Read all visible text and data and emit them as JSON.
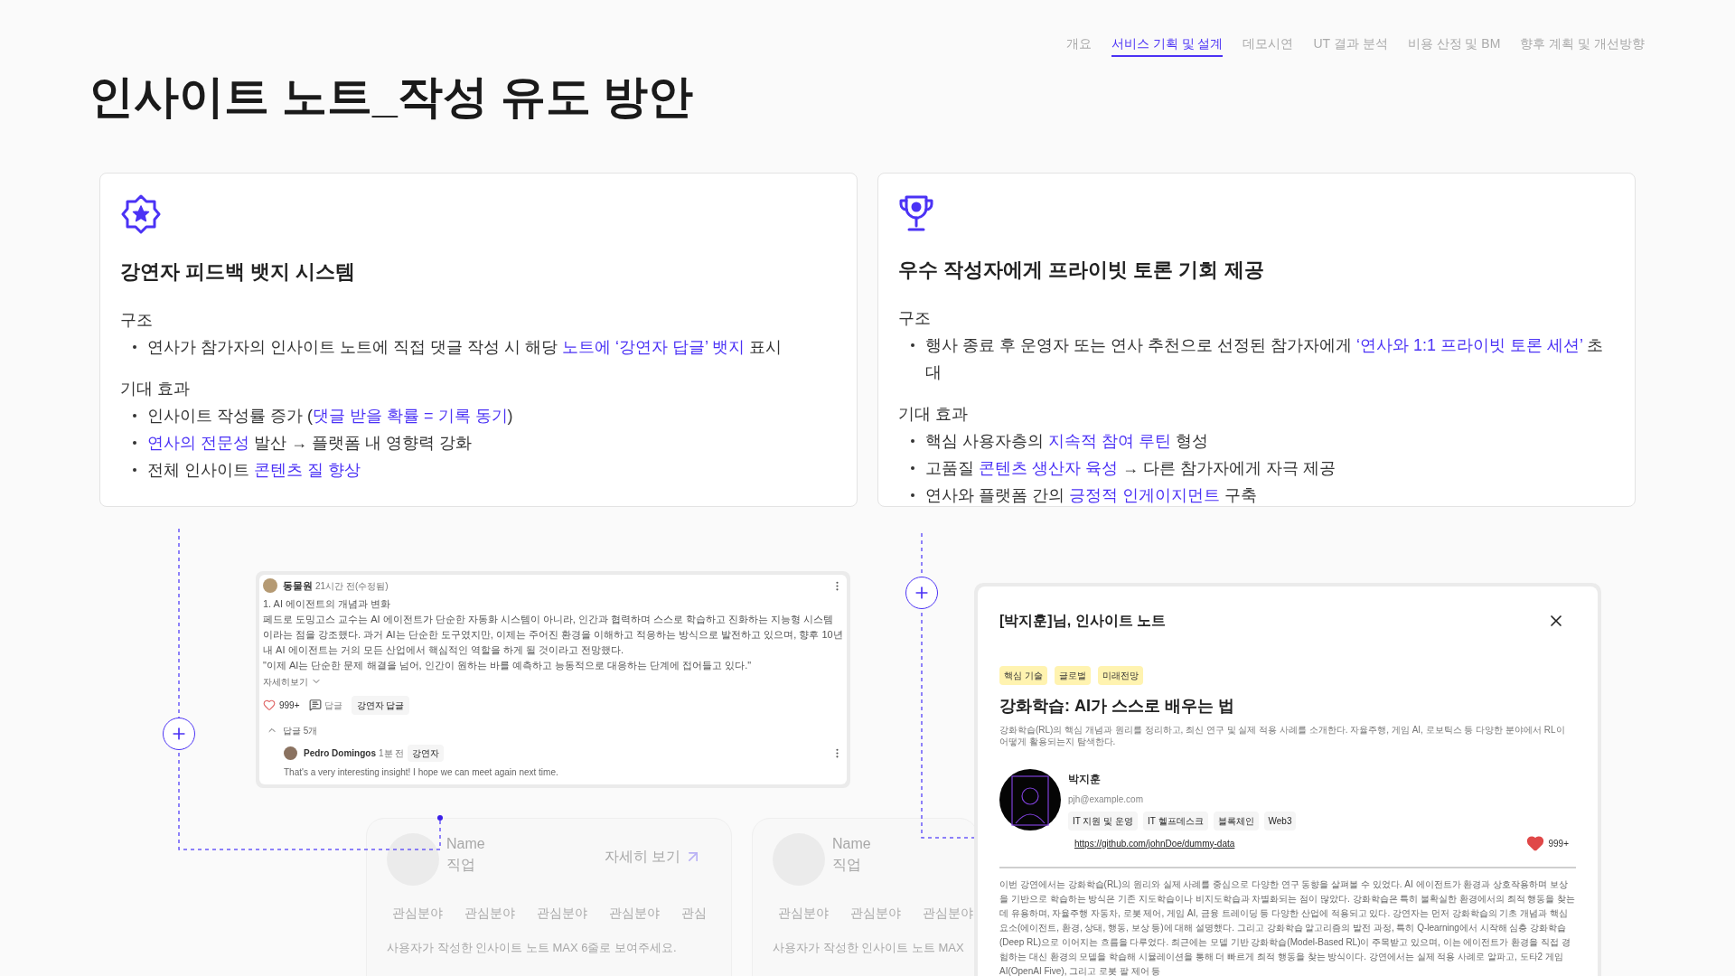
{
  "nav": [
    {
      "label": "개요",
      "selected": false
    },
    {
      "label": "서비스 기획 및 설계",
      "selected": true
    },
    {
      "label": "데모시연",
      "selected": false
    },
    {
      "label": "UT 결과 분석",
      "selected": false
    },
    {
      "label": "비용 산정 및 BM",
      "selected": false
    },
    {
      "label": "향후 계획 및 개선방향",
      "selected": false
    }
  ],
  "title": "인사이트 노트_작성 유도 방안",
  "cards": [
    {
      "kind": "badge",
      "heading": "강연자 피드백 뱃지 시스템",
      "sections": [
        {
          "label": "구조",
          "bullets": [
            [
              {
                "text": "연사가 참가자의 인사이트 노트에 직접 댓글 작성 시 해당 ",
                "accent": false
              },
              {
                "text": "노트에 ‘강연자 답글’ 뱃지",
                "accent": true
              },
              {
                "text": " 표시",
                "accent": false
              }
            ]
          ]
        },
        {
          "label": "기대 효과",
          "bullets": [
            [
              {
                "text": "인사이트 작성률 증가 (",
                "accent": false
              },
              {
                "text": "댓글 받을 확률 = 기록 동기",
                "accent": true
              },
              {
                "text": ")",
                "accent": false
              }
            ],
            [
              {
                "text": "연사의 전문성",
                "accent": true
              },
              {
                "text": " 발산 → 플랫폼 내 영향력 강화",
                "accent": false
              }
            ],
            [
              {
                "text": "전체 인사이트 ",
                "accent": false
              },
              {
                "text": "콘텐츠 질 향상",
                "accent": true
              }
            ]
          ]
        }
      ]
    },
    {
      "kind": "trophy",
      "heading": "우수 작성자에게 프라이빗 토론 기회 제공",
      "sections": [
        {
          "label": "구조",
          "bullets": [
            [
              {
                "text": "행사 종료 후 운영자 또는 연사 추천으로 선정된 참가자에게 ",
                "accent": false
              },
              {
                "text": "‘연사와 1:1 프라이빗 토론 세션’",
                "accent": true
              },
              {
                "text": " 초대",
                "accent": false
              }
            ]
          ]
        },
        {
          "label": "기대 효과",
          "bullets": [
            [
              {
                "text": "핵심 사용자층의 ",
                "accent": false
              },
              {
                "text": "지속적 참여 루틴",
                "accent": true
              },
              {
                "text": " 형성",
                "accent": false
              }
            ],
            [
              {
                "text": "고품질 ",
                "accent": false
              },
              {
                "text": "콘텐츠 생산자 육성",
                "accent": true
              },
              {
                "text": " → 다른 참가자에게 자극 제공",
                "accent": false
              }
            ],
            [
              {
                "text": "연사와 플랫폼 간의 ",
                "accent": false
              },
              {
                "text": "긍정적 인게이지먼트",
                "accent": true
              },
              {
                "text": " 구축",
                "accent": false
              }
            ]
          ]
        }
      ]
    }
  ],
  "faded_cards": [
    {
      "name": "Name",
      "job": "직업",
      "more": "자세히 보기",
      "interests": [
        "관심분야",
        "관심분야",
        "관심분야",
        "관심분야",
        "관심"
      ],
      "note": "사용자가 작성한 인사이트 노트 MAX 6줄로 보여주세요."
    },
    {
      "name": "Name",
      "job": "직업",
      "interests": [
        "관심분야",
        "관심분야",
        "관심분야"
      ],
      "note": "사용자가 작성한 인사이트 노트 MAX"
    }
  ],
  "comment": {
    "author": "동물원",
    "time": "21시간 전(수정됨)",
    "body": [
      "1. AI 에이전트의 개념과 변화",
      "페드로 도밍고스 교수는 AI 에이전트가 단순한 자동화 시스템이 아니라, 인간과 협력하며 스스로 학습하고 진화하는 지능형 시스템이라는 점을 강조했다. 과거 AI는 단순한 도구였지만, 이제는 주어진 환경을 이해하고 적응하는 방식으로 발전하고 있으며, 향후 10년 내 AI 에이전트는 거의 모든 산업에서 핵심적인 역할을 하게 될 것이라고 전망했다.",
      "\"이제 AI는 단순한 문제 해결을 넘어, 인간이 원하는 바를 예측하고 능동적으로 대응하는 단계에 접어들고 있다.\""
    ],
    "more": "자세히보기",
    "likes": "999+",
    "reply_label": "답글",
    "speaker_reply": "강연자 답글",
    "replies_toggle": "답글 5개",
    "replies_expanded": true,
    "reply": {
      "author": "Pedro Domingos",
      "time": "1분 전",
      "badge": "강연자",
      "text": "That's a very interesting insight! I hope we can meet again next time."
    }
  },
  "modal": {
    "title": "[박지훈]님, 인사이트 노트",
    "tags": [
      "핵심 기술",
      "글로벌",
      "미래전망"
    ],
    "heading": "강화학습: AI가 스스로 배우는 법",
    "summary": "강화학습(RL)의 핵심 개념과 원리를 정리하고, 최신 연구 및 실제 적용 사례를 소개한다. 자율주행, 게임 AI, 로보틱스 등 다양한 분야에서 RL이 어떻게 활용되는지 탐색한다.",
    "name": "박지훈",
    "email": "pjh@example.com",
    "interests": [
      "IT 지원 및 운영",
      "IT 헬프데스크",
      "블록체인",
      "Web3"
    ],
    "link": "https://github.com/johnDoe/dummy-data",
    "likes": "999+",
    "body": "이번 강연에서는 강화학습(RL)의 원리와 실제 사례를 중심으로 다양한 연구 동향을 살펴볼 수 있었다. AI 에이전트가 환경과 상호작용하며 보상을 기반으로 학습하는 방식은 기존 지도학습이나 비지도학습과 차별화되는 점이 많았다. 강화학습은 특히 불확실한 환경에서의 최적 행동을 찾는 데 유용하며, 자율주행 자동차, 로봇 제어, 게임 AI, 금융 트레이딩 등 다양한 산업에 적용되고 있다.  강연자는 먼저 강화학습의 기초 개념과 핵심 요소(에이전트, 환경, 상태, 행동, 보상 등)에 대해 설명했다. 그리고 강화학습 알고리즘의 발전 과정, 특히 Q-learning에서 시작해 심층 강화학습(Deep RL)으로 이어지는 흐름을 다루었다. 최근에는 모델 기반 강화학습(Model-Based RL)이 주목받고 있으며, 이는 에이전트가 환경을 직접 경험하는 대신 환경의 모델을 학습해 시뮬레이션을 통해 더 빠르게 최적 행동을 찾는 방식이다.  강연에서는 실제 적용 사례로 알파고, 도타2 게임 AI(OpenAI Five), 그리고 로봇 팔 제어 등"
  }
}
